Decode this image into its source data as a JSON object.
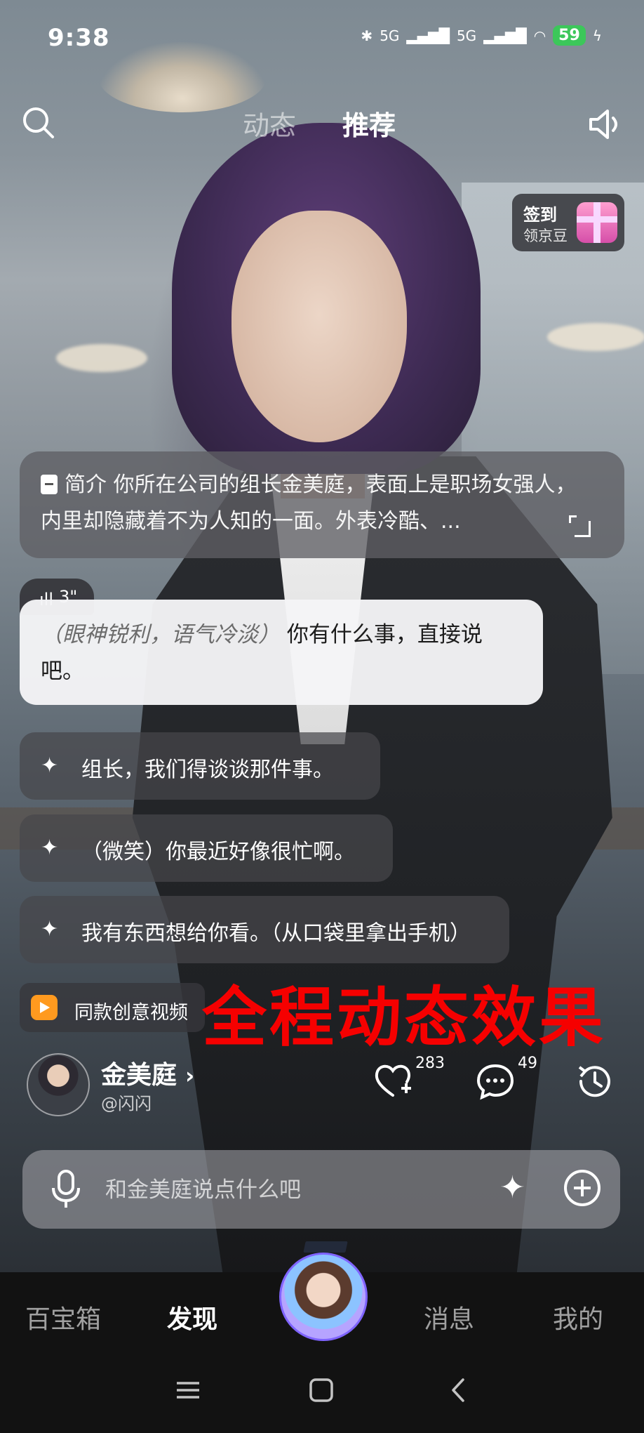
{
  "status_bar": {
    "time": "9:38",
    "network1": "5G",
    "network2": "5G",
    "battery": "59"
  },
  "top_nav": {
    "tabs": [
      "动态",
      "推荐"
    ],
    "active_tab": "推荐"
  },
  "checkin": {
    "title": "签到",
    "subtitle": "领京豆"
  },
  "intro": {
    "label": "简介",
    "text": "你所在公司的组长金美庭，表面上是职场女强人，内里却隐藏着不为人知的一面。外表冷酷、..."
  },
  "voice": {
    "duration": "3\""
  },
  "reply": {
    "action": "（眼神锐利，语气冷淡）",
    "text": "你有什么事，直接说吧。"
  },
  "suggestions": [
    "组长，我们得谈谈那件事。",
    "（微笑）你最近好像很忙啊。",
    "我有东西想给你看。（从口袋里拿出手机）"
  ],
  "same_video": {
    "label": "同款创意视频"
  },
  "overlay_caption": "全程动态效果",
  "profile": {
    "name": "金美庭",
    "handle": "@闪闪",
    "likes": "283",
    "comments": "49"
  },
  "input": {
    "placeholder": "和金美庭说点什么吧"
  },
  "bottom_nav": {
    "items": [
      "百宝箱",
      "发现",
      "消息",
      "我的"
    ],
    "active": "发现"
  },
  "colors": {
    "caption_red": "#f60000",
    "battery_green": "#3cc75a",
    "same_video_orange": "#ff9a1f"
  }
}
